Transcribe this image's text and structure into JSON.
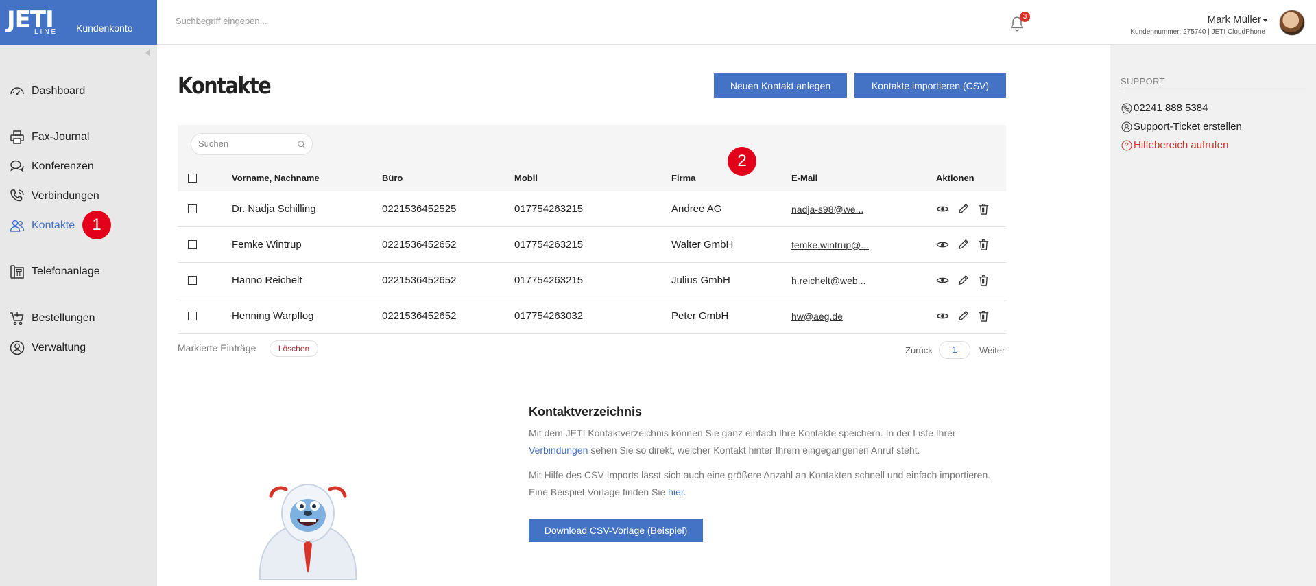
{
  "brand": {
    "logo_main": "JETI",
    "logo_sub": "LINE",
    "account_label": "Kundenkonto"
  },
  "header": {
    "search_placeholder": "Suchbegriff eingeben...",
    "notification_count": "3",
    "user_name": "Mark Müller",
    "customer_info": "Kundennummer: 275740 | JETI CloudPhone"
  },
  "sidebar": {
    "items": [
      {
        "label": "Dashboard",
        "icon": "speedometer-icon"
      },
      {
        "label": "Fax-Journal",
        "icon": "printer-icon"
      },
      {
        "label": "Konferenzen",
        "icon": "chat-bubbles-icon"
      },
      {
        "label": "Verbindungen",
        "icon": "phone-call-icon"
      },
      {
        "label": "Kontakte",
        "icon": "users-icon",
        "active": true
      },
      {
        "label": "Telefonanlage",
        "icon": "fax-machine-icon"
      },
      {
        "label": "Bestellungen",
        "icon": "cart-icon"
      },
      {
        "label": "Verwaltung",
        "icon": "user-circle-icon"
      }
    ]
  },
  "markers": {
    "m1": "1",
    "m2": "2"
  },
  "main": {
    "title": "Kontakte",
    "new_contact_label": "Neuen Kontakt anlegen",
    "import_label": "Kontakte importieren (CSV)",
    "table_search_placeholder": "Suchen",
    "columns": [
      "Vorname, Nachname",
      "Büro",
      "Mobil",
      "Firma",
      "E-Mail",
      "Aktionen"
    ],
    "rows": [
      {
        "name": "Dr. Nadja Schilling",
        "office": "0221536452525",
        "mobile": "017754263215",
        "company": "Andree AG",
        "email": "nadja-s98@we..."
      },
      {
        "name": "Femke Wintrup",
        "office": "0221536452652",
        "mobile": "017754263215",
        "company": "Walter GmbH",
        "email": "femke.wintrup@..."
      },
      {
        "name": "Hanno Reichelt",
        "office": "0221536452652",
        "mobile": "017754263215",
        "company": "Julius GmbH",
        "email": "h.reichelt@web..."
      },
      {
        "name": "Henning Warpflog",
        "office": "0221536452652",
        "mobile": "017754263032",
        "company": "Peter GmbH",
        "email": "hw@aeg.de"
      }
    ],
    "marked_label": "Markierte Einträge",
    "delete_label": "Löschen",
    "pager": {
      "back": "Zurück",
      "page": "1",
      "next": "Weiter"
    }
  },
  "info": {
    "title": "Kontaktverzeichnis",
    "p1_before": "Mit dem JETI Kontaktverzeichnis können Sie ganz einfach Ihre Kontakte speichern. In der Liste Ihrer",
    "p1_link": "Verbindungen",
    "p1_after": "sehen Sie so direkt, welcher Kontakt hinter Ihrem eingegangenen Anruf steht.",
    "p2_before": "Mit Hilfe des CSV-Imports lässt sich auch eine größere Anzahl an Kontakten schnell und einfach importieren. Eine Beispiel-Vorlage finden Sie",
    "p2_link": "hier",
    "p2_after": ".",
    "download_label": "Download CSV-Vorlage (Beispiel)"
  },
  "support": {
    "heading": "SUPPORT",
    "phone": "02241 888 5384",
    "ticket": "Support-Ticket erstellen",
    "help": "Hilfebereich aufrufen"
  },
  "colors": {
    "accent": "#4472c4",
    "sidebar_bg": "#e8e8e8",
    "marker_red": "#e3001b",
    "help_red": "#d9302c"
  }
}
